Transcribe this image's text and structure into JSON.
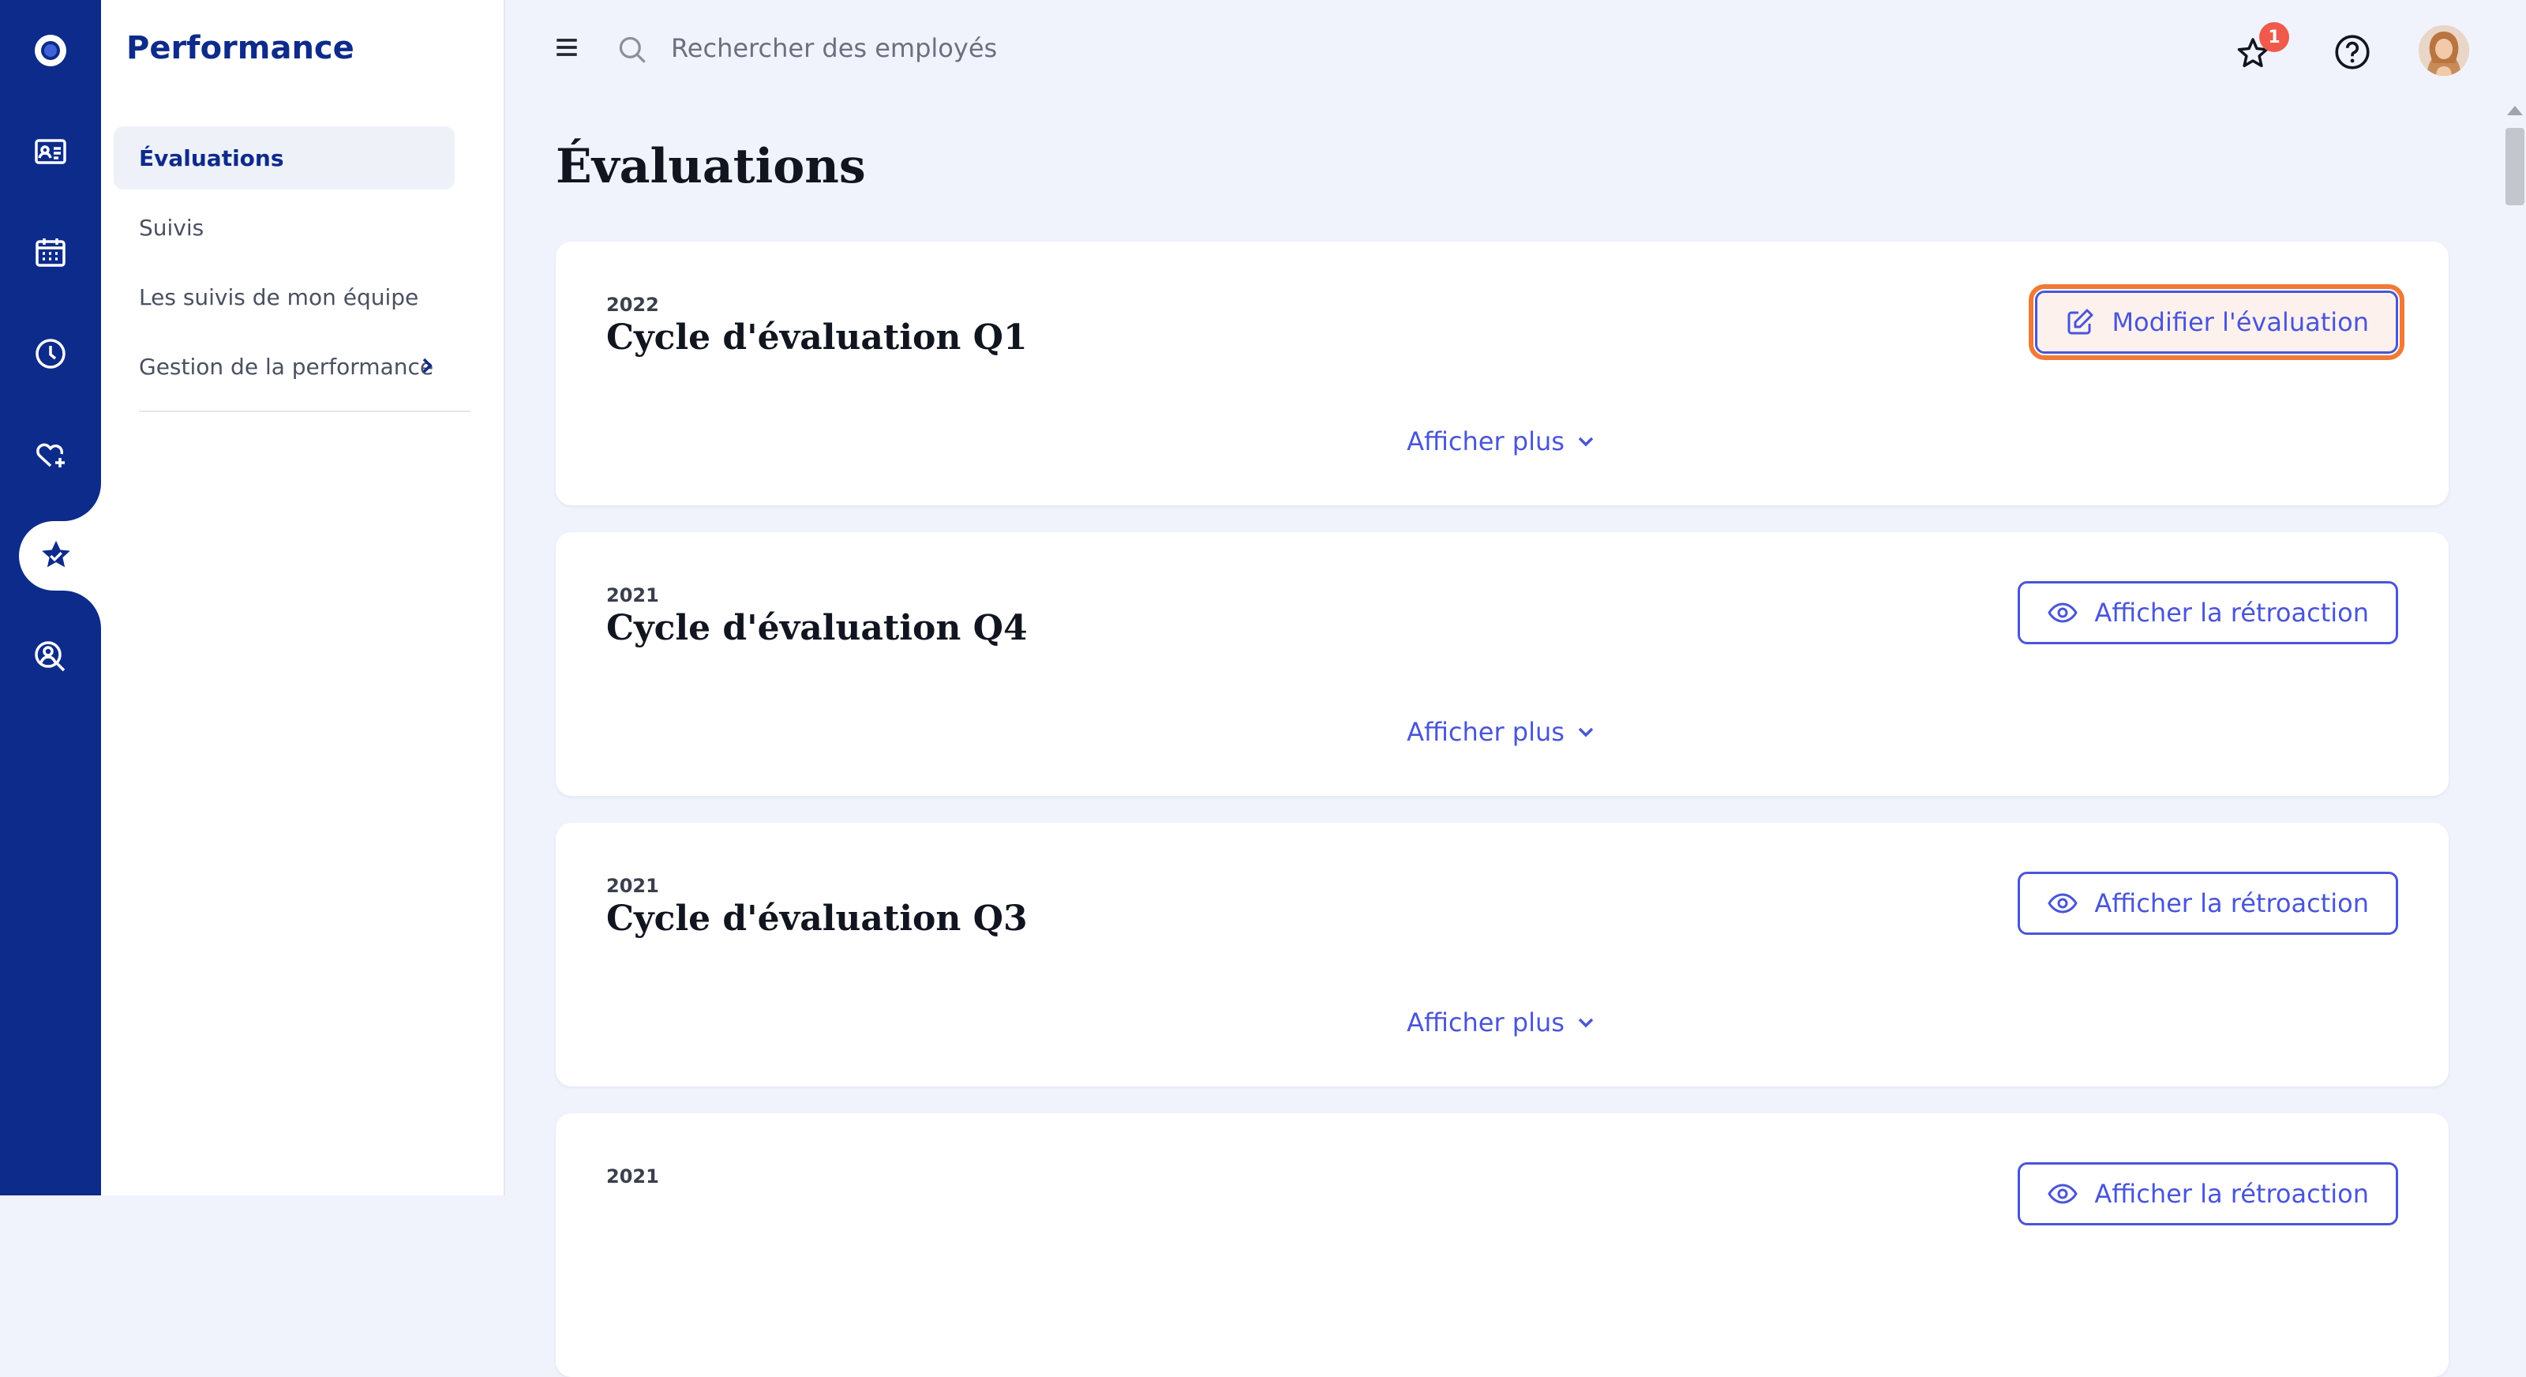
{
  "sidebar": {
    "title": "Performance",
    "items": [
      {
        "label": "Évaluations",
        "active": true
      },
      {
        "label": "Suivis",
        "active": false
      },
      {
        "label": "Les suivis de mon équipe",
        "active": false
      },
      {
        "label": "Gestion de la performance",
        "active": false,
        "has_submenu": true
      }
    ]
  },
  "rail": {
    "icons": [
      "logo-icon",
      "id-card-icon",
      "calendar-icon",
      "clock-icon",
      "heart-plus-icon",
      "star-check-icon",
      "search-person-icon"
    ],
    "active": "star-check-icon"
  },
  "topbar": {
    "search_placeholder": "Rechercher des employés",
    "notification_count": "1"
  },
  "main": {
    "page_title": "Évaluations",
    "cards": [
      {
        "year": "2022",
        "title": "Cycle d'évaluation Q1",
        "button": "Modifier l'évaluation",
        "button_icon": "edit-icon",
        "show_more": "Afficher plus"
      },
      {
        "year": "2021",
        "title": "Cycle d'évaluation Q4",
        "button": "Afficher la rétroaction",
        "button_icon": "eye-icon",
        "show_more": "Afficher plus"
      },
      {
        "year": "2021",
        "title": "Cycle d'évaluation Q3",
        "button": "Afficher la rétroaction",
        "button_icon": "eye-icon",
        "show_more": "Afficher plus"
      },
      {
        "year": "2021",
        "title": "",
        "button": "Afficher la rétroaction",
        "button_icon": "eye-icon",
        "show_more": ""
      }
    ]
  },
  "colors": {
    "rail": "#0d2b8a",
    "accent": "#4a55d8",
    "highlight": "#f07a36",
    "badge": "#f05a4d",
    "background": "#f0f3fb"
  }
}
